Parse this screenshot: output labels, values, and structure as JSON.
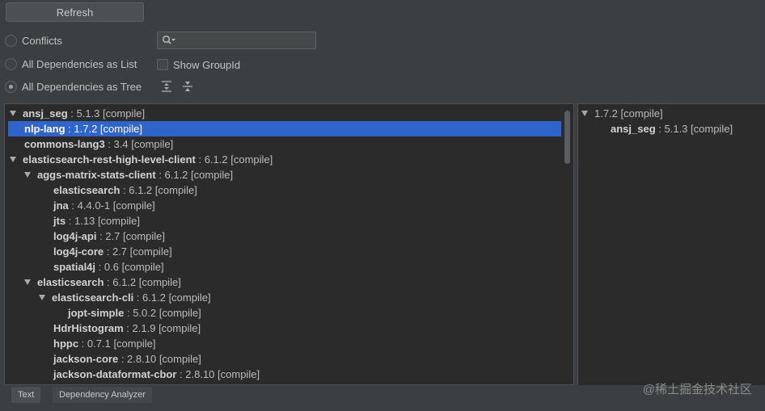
{
  "toolbar": {
    "refresh_label": "Refresh"
  },
  "options": {
    "conflicts_label": "Conflicts",
    "list_label": "All Dependencies as List",
    "tree_label": "All Dependencies as Tree",
    "selected": "tree",
    "show_groupid_label": "Show GroupId",
    "search_value": ""
  },
  "icons": {
    "search": "search-icon",
    "expand_all": "expand-all-icon",
    "collapse_all": "collapse-all-icon"
  },
  "colors": {
    "selection": "#2f65ca",
    "background": "#3c3f41",
    "pane": "#2b2b2b"
  },
  "tree": {
    "rows": [
      {
        "name": "ansj_seg",
        "version": "5.1.3",
        "scope": "[compile]",
        "level": 0,
        "expandable": true,
        "selected": false
      },
      {
        "name": "nlp-lang",
        "version": "1.7.2",
        "scope": "[compile]",
        "level": 1,
        "expandable": false,
        "selected": true
      },
      {
        "name": "commons-lang3",
        "version": "3.4",
        "scope": "[compile]",
        "level": 0,
        "expandable": false,
        "selected": false
      },
      {
        "name": "elasticsearch-rest-high-level-client",
        "version": "6.1.2",
        "scope": "[compile]",
        "level": 0,
        "expandable": true,
        "selected": false
      },
      {
        "name": "aggs-matrix-stats-client",
        "version": "6.1.2",
        "scope": "[compile]",
        "level": 1,
        "expandable": true,
        "selected": false
      },
      {
        "name": "elasticsearch",
        "version": "6.1.2",
        "scope": "[compile]",
        "level": 2,
        "expandable": false,
        "selected": false
      },
      {
        "name": "jna",
        "version": "4.4.0-1",
        "scope": "[compile]",
        "level": 2,
        "expandable": false,
        "selected": false
      },
      {
        "name": "jts",
        "version": "1.13",
        "scope": "[compile]",
        "level": 2,
        "expandable": false,
        "selected": false
      },
      {
        "name": "log4j-api",
        "version": "2.7",
        "scope": "[compile]",
        "level": 2,
        "expandable": false,
        "selected": false
      },
      {
        "name": "log4j-core",
        "version": "2.7",
        "scope": "[compile]",
        "level": 2,
        "expandable": false,
        "selected": false
      },
      {
        "name": "spatial4j",
        "version": "0.6",
        "scope": "[compile]",
        "level": 2,
        "expandable": false,
        "selected": false
      },
      {
        "name": "elasticsearch",
        "version": "6.1.2",
        "scope": "[compile]",
        "level": 1,
        "expandable": true,
        "selected": false
      },
      {
        "name": "elasticsearch-cli",
        "version": "6.1.2",
        "scope": "[compile]",
        "level": 2,
        "expandable": true,
        "selected": false
      },
      {
        "name": "jopt-simple",
        "version": "5.0.2",
        "scope": "[compile]",
        "level": 3,
        "expandable": false,
        "selected": false
      },
      {
        "name": "HdrHistogram",
        "version": "2.1.9",
        "scope": "[compile]",
        "level": 2,
        "expandable": false,
        "selected": false
      },
      {
        "name": "hppc",
        "version": "0.7.1",
        "scope": "[compile]",
        "level": 2,
        "expandable": false,
        "selected": false
      },
      {
        "name": "jackson-core",
        "version": "2.8.10",
        "scope": "[compile]",
        "level": 2,
        "expandable": false,
        "selected": false
      },
      {
        "name": "jackson-dataformat-cbor",
        "version": "2.8.10",
        "scope": "[compile]",
        "level": 2,
        "expandable": false,
        "selected": false
      }
    ]
  },
  "usages": {
    "rows": [
      {
        "name": "",
        "version": "1.7.2",
        "scope": "[compile]",
        "level": 0,
        "expandable": true
      },
      {
        "name": "ansj_seg",
        "version": "5.1.3",
        "scope": "[compile]",
        "level": 1,
        "expandable": false
      }
    ]
  },
  "tabs": [
    {
      "label": "Text",
      "active": true
    },
    {
      "label": "Dependency Analyzer",
      "active": false
    }
  ],
  "watermark": "@稀土掘金技术社区"
}
